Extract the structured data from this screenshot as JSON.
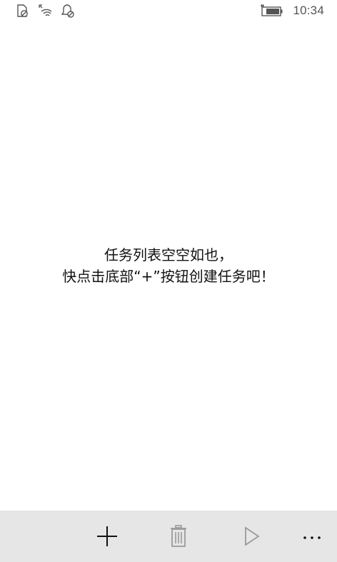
{
  "status_bar": {
    "icons_left": [
      "no-sim-icon",
      "wifi-icon",
      "quiet-hours-icon"
    ],
    "battery": "charging-battery-icon",
    "time": "10:34"
  },
  "empty_state": {
    "line1": "任务列表空空如也，",
    "line2": "快点击底部“+”按钮创建任务吧！"
  },
  "app_bar": {
    "buttons": [
      {
        "name": "add",
        "icon": "plus-icon"
      },
      {
        "name": "delete",
        "icon": "trash-icon",
        "disabled": true
      },
      {
        "name": "start",
        "icon": "play-icon",
        "disabled": true
      },
      {
        "name": "more",
        "icon": "more-icon"
      }
    ]
  },
  "colors": {
    "background": "#ffffff",
    "app_bar_background": "#e6e6e6",
    "icon_active": "#111111",
    "icon_disabled": "#9a9a9a",
    "status_text": "#555555"
  }
}
